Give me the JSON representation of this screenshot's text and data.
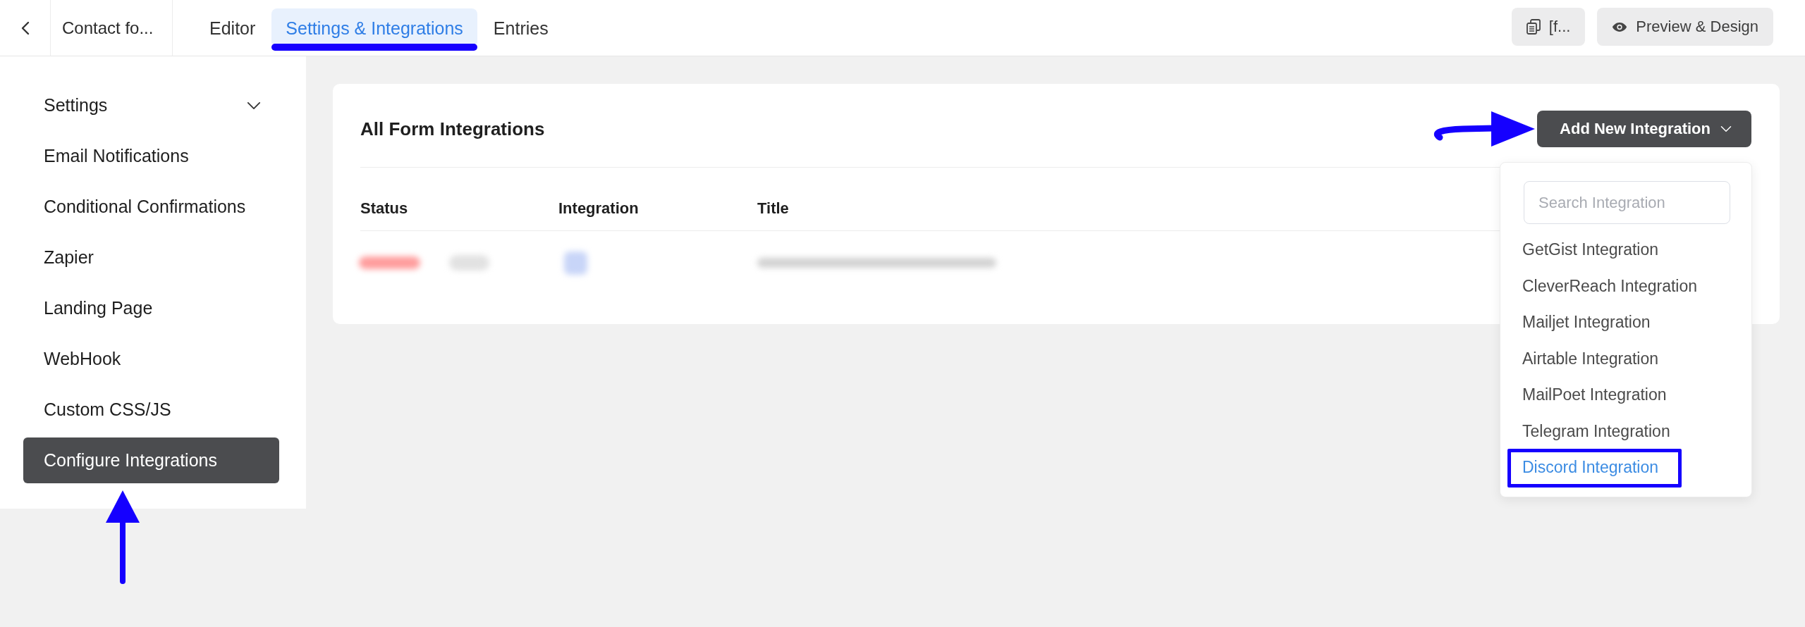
{
  "top_bar": {
    "form_title": "Contact fo...",
    "tabs": [
      {
        "label": "Editor",
        "selected": false,
        "annotated": false
      },
      {
        "label": "Settings & Integrations",
        "selected": true,
        "annotated": true
      },
      {
        "label": "Entries",
        "selected": false,
        "annotated": false
      }
    ],
    "actions": [
      {
        "kind": "shortcode",
        "label": "[f..."
      },
      {
        "kind": "preview",
        "label": "Preview & Design"
      }
    ]
  },
  "sidebar": {
    "items": [
      {
        "label": "Settings",
        "kind": "group",
        "selected": false,
        "annotated": false
      },
      {
        "label": "Email Notifications",
        "kind": "link",
        "selected": false,
        "annotated": false
      },
      {
        "label": "Conditional Confirmations",
        "kind": "link",
        "selected": false,
        "annotated": false
      },
      {
        "label": "Zapier",
        "kind": "link",
        "selected": false,
        "annotated": false
      },
      {
        "label": "Landing Page",
        "kind": "link",
        "selected": false,
        "annotated": false
      },
      {
        "label": "WebHook",
        "kind": "link",
        "selected": false,
        "annotated": false
      },
      {
        "label": "Custom CSS/JS",
        "kind": "link",
        "selected": false,
        "annotated": false
      },
      {
        "label": "Configure Integrations",
        "kind": "link",
        "selected": true,
        "annotated": true
      }
    ]
  },
  "integrations_card": {
    "title": "All Form Integrations",
    "add_button": {
      "label": "Add New Integration",
      "annotated": true
    },
    "table": {
      "columns": [
        "Status",
        "Integration",
        "Title"
      ],
      "rows": [
        {
          "blurred": true
        }
      ]
    },
    "dropdown": {
      "open": true,
      "search": {
        "placeholder": "Search Integration"
      },
      "items": [
        {
          "label": "GetGist Integration",
          "selected": false,
          "annotated": false
        },
        {
          "label": "CleverReach Integration",
          "selected": false,
          "annotated": false
        },
        {
          "label": "Mailjet Integration",
          "selected": false,
          "annotated": false
        },
        {
          "label": "Airtable Integration",
          "selected": false,
          "annotated": false
        },
        {
          "label": "MailPoet Integration",
          "selected": false,
          "annotated": false
        },
        {
          "label": "Telegram Integration",
          "selected": false,
          "annotated": false
        },
        {
          "label": "Discord Integration",
          "selected": true,
          "annotated": true
        }
      ]
    }
  }
}
